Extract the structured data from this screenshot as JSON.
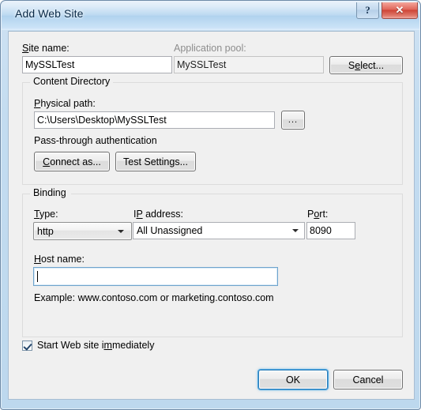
{
  "window": {
    "title": "Add Web Site",
    "help_button": "?",
    "close_button": "✕"
  },
  "site_name": {
    "label_pre": "S",
    "label_acc": "",
    "label": "Site name:",
    "value": "MySSLTest"
  },
  "app_pool": {
    "label": "Application pool:",
    "value": "MySSLTest",
    "select_button": "Select..."
  },
  "content_directory": {
    "legend": "Content Directory",
    "physical_path_label": "Physical path:",
    "physical_path_value": "C:\\Users\\Desktop\\MySSLTest",
    "browse_button": "...",
    "passthrough_label": "Pass-through authentication",
    "connect_as_button": "Connect as...",
    "test_settings_button": "Test Settings..."
  },
  "binding": {
    "legend": "Binding",
    "type_label": "Type:",
    "type_value": "http",
    "ip_label": "IP address:",
    "ip_value": "All Unassigned",
    "port_label": "Port:",
    "port_value": "8090",
    "host_label": "Host name:",
    "host_value": "",
    "example_text": "Example: www.contoso.com or marketing.contoso.com"
  },
  "footer": {
    "start_checkbox_label": "Start Web site immediately",
    "start_checked": true,
    "ok_button": "OK",
    "cancel_button": "Cancel"
  },
  "colors": {
    "accent": "#49a3e0",
    "close_red": "#cd4436",
    "client_bg": "#f0f0f0",
    "frame_blue": "#bdd8ee"
  }
}
